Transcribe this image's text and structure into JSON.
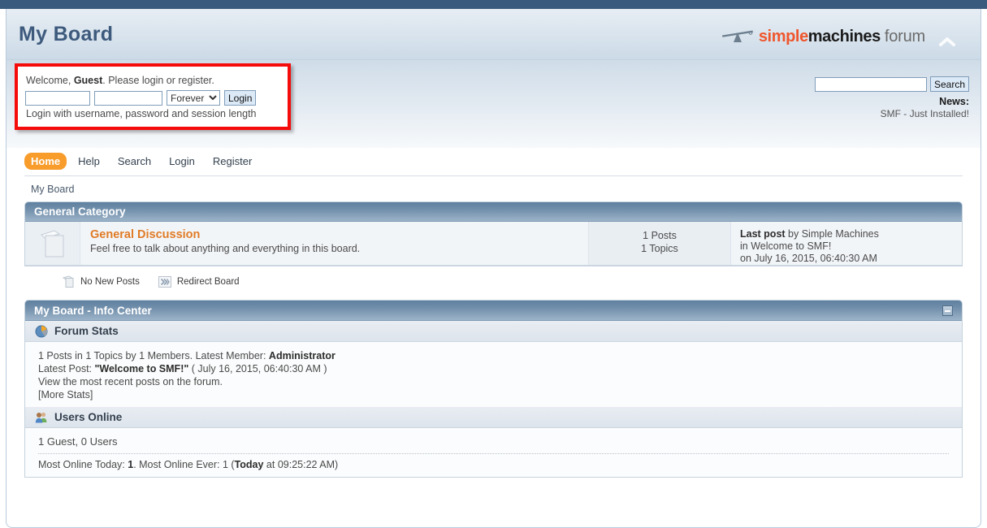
{
  "header": {
    "board_title": "My Board",
    "logo": {
      "part1": "simple",
      "part2": "machines",
      "part3": "forum",
      "seesaw_icon": "seesaw-icon"
    },
    "collapse_icon": "chevron-up-icon",
    "colors": {
      "top_strip": "#3a5a7d",
      "title": "#3d5a7d",
      "logo_orange": "#ef562d",
      "logo_black": "#1b1b1b",
      "logo_gray": "#6b6b6b"
    }
  },
  "login": {
    "welcome_prefix": "Welcome, ",
    "guest": "Guest",
    "welcome_suffix": ". Please login or register.",
    "username_value": "",
    "username_placeholder": "",
    "password_value": "",
    "password_placeholder": "",
    "session_length_selected": "Forever",
    "session_length_options": [
      "Forever"
    ],
    "login_button": "Login",
    "hint": "Login with username, password and session length",
    "highlight_color": "#f60b0b"
  },
  "search": {
    "value": "",
    "placeholder": "",
    "button_label": "Search"
  },
  "news": {
    "label": "News:",
    "text": "SMF - Just Installed!"
  },
  "nav": {
    "items": [
      {
        "label": "Home",
        "active": true
      },
      {
        "label": "Help",
        "active": false
      },
      {
        "label": "Search",
        "active": false
      },
      {
        "label": "Login",
        "active": false
      },
      {
        "label": "Register",
        "active": false
      }
    ],
    "active_color": "#f89c2c"
  },
  "breadcrumb": {
    "text": "My Board"
  },
  "category": {
    "title": "General Category",
    "board": {
      "icon": "board-no-new-posts-icon",
      "name": "General Discussion",
      "description": "Feel free to talk about anything and everything in this board.",
      "posts": "1 Posts",
      "topics": "1 Topics",
      "last_post_label": "Last post",
      "last_post_by": " by Simple Machines",
      "last_post_in": "in Welcome to SMF!",
      "last_post_on": "on July 16, 2015, 06:40:30 AM"
    }
  },
  "legend": {
    "items": [
      {
        "label": "No New Posts",
        "icon": "no-new-posts-icon"
      },
      {
        "label": "Redirect Board",
        "icon": "redirect-board-icon"
      }
    ]
  },
  "info_center": {
    "title": "My Board - Info Center",
    "collapse_icon": "collapse-box-icon",
    "forum_stats": {
      "icon": "pie-chart-icon",
      "title": "Forum Stats",
      "line1_a": "1 Posts in 1 Topics by 1 Members. Latest Member: ",
      "line1_b": "Administrator",
      "line2_a": "Latest Post: ",
      "line2_b": "\"Welcome to SMF!\"",
      "line2_c": " ( July 16, 2015, 06:40:30 AM )",
      "line3": "View the most recent posts on the forum.",
      "line4": "[More Stats]"
    },
    "users_online": {
      "icon": "users-online-icon",
      "title": "Users Online",
      "summary": "1 Guest, 0 Users",
      "most_online_a": "Most Online Today: ",
      "most_online_b": "1",
      "most_online_c": ".  Most Online Ever: 1 (",
      "most_online_d": "Today",
      "most_online_e": " at 09:25:22 AM)"
    }
  }
}
